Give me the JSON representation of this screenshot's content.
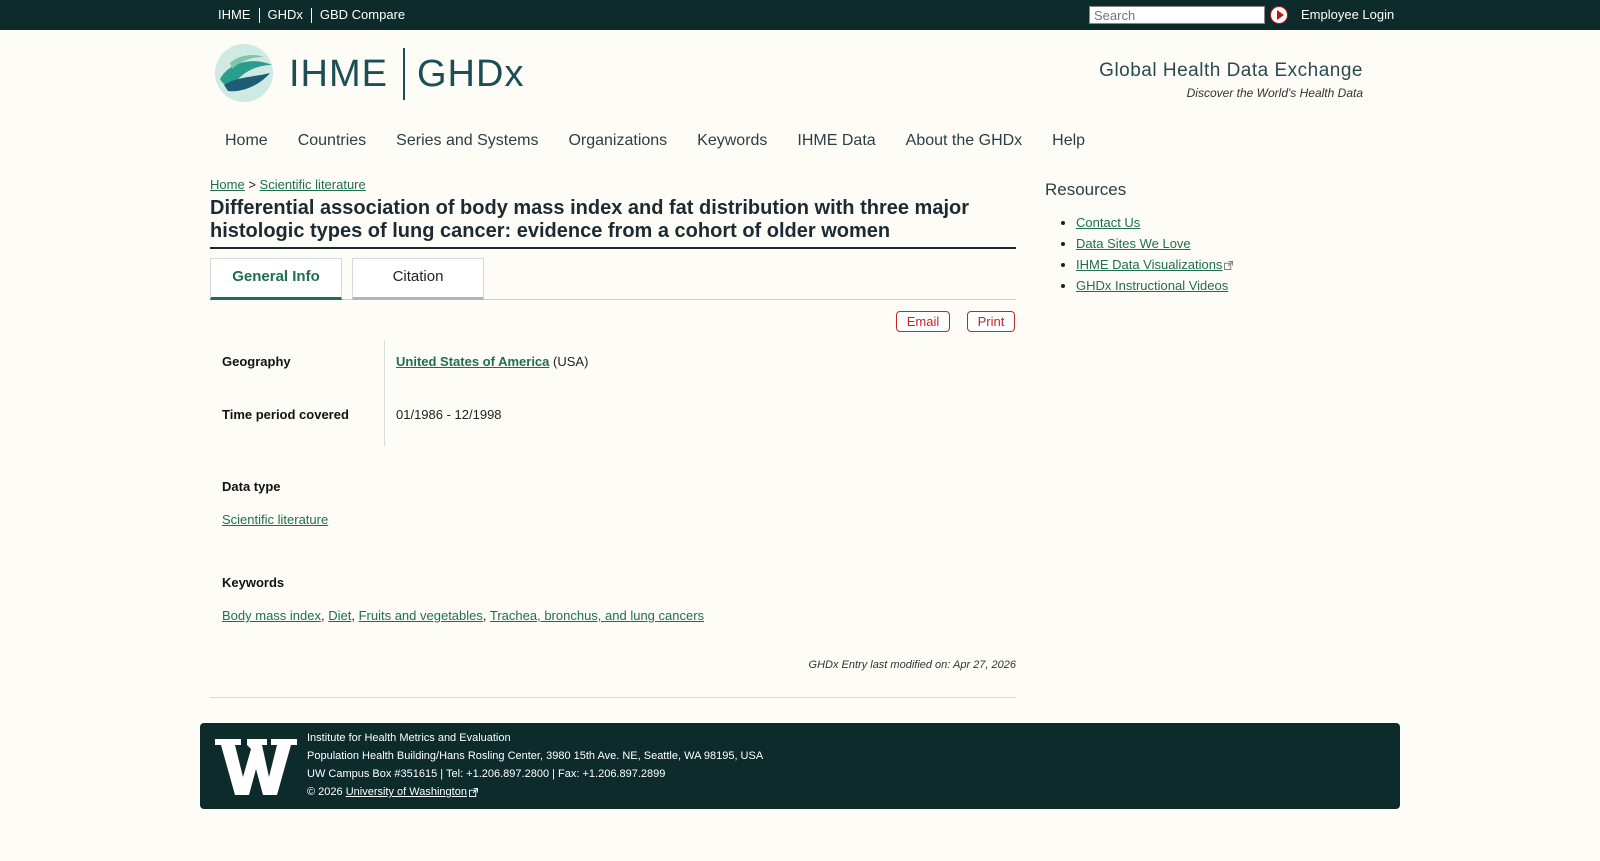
{
  "topbar": {
    "links": [
      "IHME",
      "GHDx",
      "GBD Compare"
    ],
    "search_placeholder": "Search",
    "employee_login": "Employee Login"
  },
  "brand": {
    "ihme": "IHME",
    "ghdx": "GHDx",
    "tagline_title": "Global Health Data Exchange",
    "tagline_sub": "Discover the World's Health Data"
  },
  "nav": [
    "Home",
    "Countries",
    "Series and Systems",
    "Organizations",
    "Keywords",
    "IHME Data",
    "About the GHDx",
    "Help"
  ],
  "breadcrumb": {
    "home": "Home",
    "separator": ">",
    "current": "Scientific literature"
  },
  "title": "Differential association of body mass index and fat distribution with three major histologic types of lung cancer: evidence from a cohort of older women",
  "tabs": {
    "general": "General Info",
    "citation": "Citation"
  },
  "actions": {
    "email": "Email",
    "print": "Print"
  },
  "info": {
    "geography_label": "Geography",
    "geography_link": "United States of America",
    "geography_suffix": "(USA)",
    "time_label": "Time period covered",
    "time_value": "01/1986 - 12/1998"
  },
  "data_type": {
    "label": "Data type",
    "value": "Scientific literature"
  },
  "keywords": {
    "label": "Keywords",
    "items": [
      "Body mass index",
      "Diet",
      "Fruits and vegetables",
      "Trachea, bronchus, and lung cancers"
    ]
  },
  "modified": "GHDx Entry last modified on: Apr 27, 2026",
  "resources": {
    "title": "Resources",
    "items": [
      "Contact Us",
      "Data Sites We Love",
      "IHME Data Visualizations",
      "GHDx Instructional Videos"
    ]
  },
  "footer": {
    "line1": "Institute for Health Metrics and Evaluation",
    "line2": "Population Health Building/Hans Rosling Center, 3980 15th Ave. NE, Seattle, WA 98195, USA",
    "line3": "UW Campus Box #351615 | Tel: +1.206.897.2800 | Fax: +1.206.897.2899",
    "copyright": "© 2026",
    "uw_link": "University of Washington"
  },
  "colors": {
    "topbar": "#0d2b2b",
    "link": "#1f6e52",
    "action": "#c0262c"
  }
}
